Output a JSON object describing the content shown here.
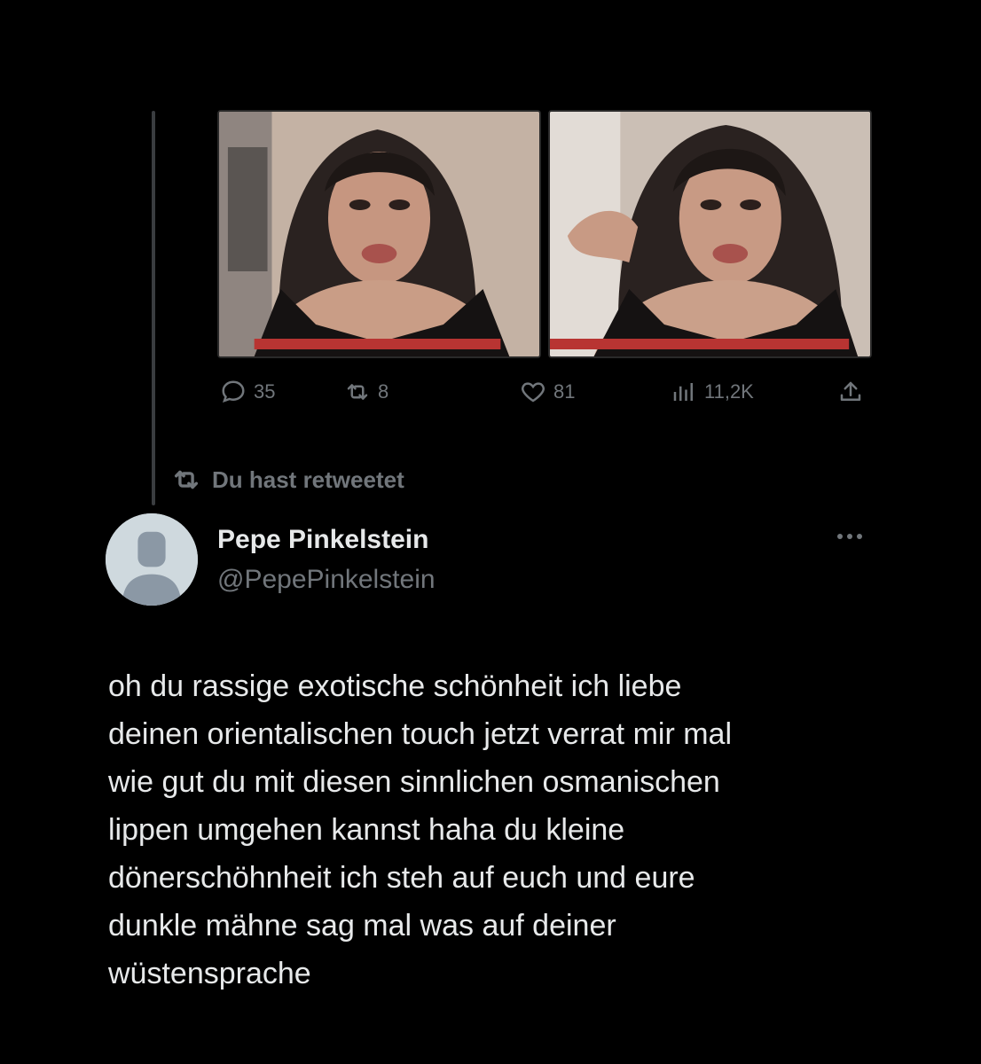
{
  "previous_tweet": {
    "stats": {
      "replies": "35",
      "retweets": "8",
      "likes": "81",
      "views": "11,2K"
    }
  },
  "retweet_note": "Du hast retweetet",
  "tweet": {
    "author": {
      "display_name": "Pepe Pinkelstein",
      "handle": "@PepePinkelstein"
    },
    "text_lines": [
      "oh du rassige exotische schönheit ich liebe",
      "deinen orientalischen touch jetzt verrat mir mal",
      "wie gut du mit diesen sinnlichen osmanischen",
      "lippen umgehen kannst haha du kleine",
      "dönerschöhnheit ich steh auf euch und eure",
      "dunkle mähne sag mal was auf deiner",
      "wüstensprache"
    ]
  },
  "icons": {
    "reply": "reply-icon",
    "retweet": "retweet-icon",
    "like": "heart-icon",
    "views": "views-icon",
    "share": "share-icon",
    "more": "more-icon"
  },
  "colors": {
    "background": "#000000",
    "text_primary": "#e7e9ea",
    "text_secondary": "#71767b",
    "thread_line": "#3a3d40"
  }
}
